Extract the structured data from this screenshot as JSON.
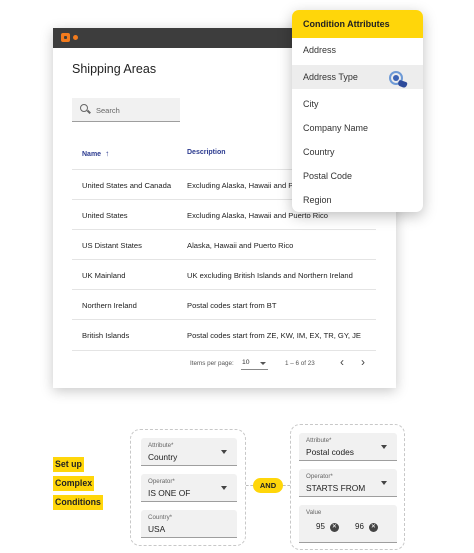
{
  "window": {
    "title": "Shipping Areas",
    "search": {
      "placeholder": "Search",
      "value": ""
    },
    "columns": {
      "name": "Name",
      "description": "Description"
    },
    "rows": [
      {
        "name": "United States and Canada",
        "description": "Excluding Alaska, Hawaii and Puerto Rico"
      },
      {
        "name": "United States",
        "description": "Excluding Alaska, Hawaii and Puerto Rico"
      },
      {
        "name": "US Distant States",
        "description": "Alaska, Hawaii and Puerto Rico"
      },
      {
        "name": "UK Mainland",
        "description": "UK excluding British Islands and Northern Ireland"
      },
      {
        "name": "Northern Ireland",
        "description": "Postal codes start from BT"
      },
      {
        "name": "British Islands",
        "description": "Postal codes start from ZE, KW, IM, EX, TR, GY, JE"
      }
    ],
    "pagination": {
      "items_per_page_label": "Items per page:",
      "items_per_page": "10",
      "range": "1 – 6 of 23"
    }
  },
  "dropdown": {
    "header": "Condition Attributes",
    "items": [
      "Address",
      "Address Type",
      "City",
      "Company Name",
      "Country",
      "Postal Code",
      "Region"
    ],
    "active_item": "Address Type"
  },
  "callout": {
    "lines": [
      "Set up",
      "Complex",
      "Conditions"
    ]
  },
  "conditions": {
    "left": {
      "attribute": {
        "label": "Attribute*",
        "value": "Country"
      },
      "operator": {
        "label": "Operator*",
        "value": "IS ONE OF"
      },
      "country": {
        "label": "Country*",
        "value": "USA"
      }
    },
    "joiner": "AND",
    "right": {
      "attribute": {
        "label": "Attribute*",
        "value": "Postal codes"
      },
      "operator": {
        "label": "Operator*",
        "value": "STARTS FROM"
      },
      "value": {
        "label": "Value",
        "chips": [
          "95",
          "96"
        ]
      }
    }
  },
  "colors": {
    "accent": "#ffd60a",
    "titlebar": "#3d3d3d",
    "logo": "#f37b1d",
    "header_text": "#2b3a8f"
  }
}
